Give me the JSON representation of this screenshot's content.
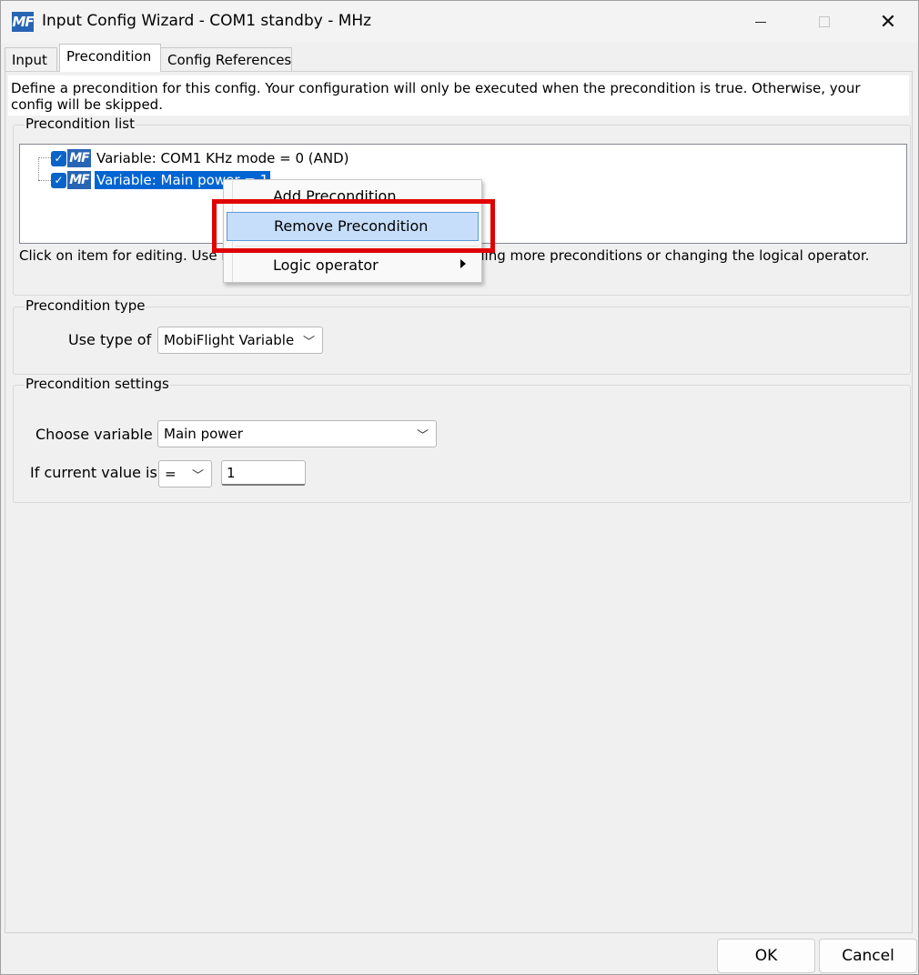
{
  "window": {
    "icon_text": "MF",
    "title": "Input Config Wizard - COM1 standby - MHz",
    "controls": {
      "minimize": "",
      "maximize": "",
      "close": "✕"
    }
  },
  "tabs": [
    {
      "label": "Input",
      "active": false
    },
    {
      "label": "Precondition",
      "active": true
    },
    {
      "label": "Config References",
      "active": false
    }
  ],
  "description": "Define a precondition for this config. Your configuration will only be executed when the precondition is true. Otherwise, your config will be skipped.",
  "precondition_list": {
    "legend": "Precondition list",
    "items": [
      {
        "label": "Variable: COM1 KHz mode = 0  (AND)",
        "checked": true,
        "selected": false
      },
      {
        "label": "Variable: Main power = 1",
        "checked": true,
        "selected": true
      }
    ],
    "hint": "Click on item for editing. Use r",
    "hint_tail": "dding more preconditions or changing the logical operator."
  },
  "context_menu": {
    "items": [
      {
        "label": "Add Precondition"
      },
      {
        "label": "Remove Precondition",
        "highlighted": true
      },
      {
        "label": "Logic operator",
        "has_submenu": true
      }
    ]
  },
  "precondition_type": {
    "legend": "Precondition type",
    "label": "Use type of",
    "value": "MobiFlight Variable"
  },
  "precondition_settings": {
    "legend": "Precondition settings",
    "variable_label": "Choose variable",
    "variable_value": "Main power",
    "value_label": "If current value is",
    "operator_value": "=",
    "compare_value": "1"
  },
  "buttons": {
    "ok": "OK",
    "cancel": "Cancel"
  },
  "colors": {
    "accent": "#0064d2",
    "highlight_border": "#e00000",
    "menu_hover": "#c6defa"
  }
}
